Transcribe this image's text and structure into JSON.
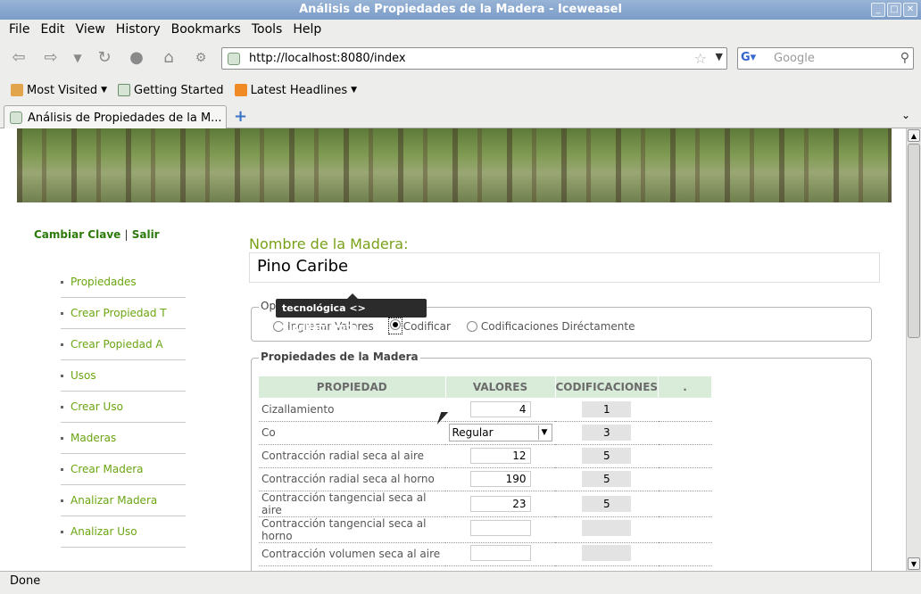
{
  "window": {
    "title": "Análisis de Propiedades de la Madera - Iceweasel"
  },
  "menu": [
    "File",
    "Edit",
    "View",
    "History",
    "Bookmarks",
    "Tools",
    "Help"
  ],
  "nav": {
    "url": "http://localhost:8080/index",
    "search_placeholder": "Google"
  },
  "bookmarks": [
    "Most Visited",
    "Getting Started",
    "Latest Headlines"
  ],
  "tab": {
    "title": "Análisis de Propiedades de la M..."
  },
  "page": {
    "top_links": {
      "change_password": "Cambiar Clave",
      "separator": "|",
      "logout": "Salir"
    },
    "sidebar": [
      "Propiedades",
      "Crear Propiedad T",
      "Crear Popiedad A",
      "Usos",
      "Crear Uso",
      "Maderas",
      "Crear Madera",
      "Analizar Madera",
      "Analizar Uso"
    ],
    "wood_label": "Nombre de la Madera:",
    "wood_name": "Pino Caribe",
    "options": {
      "legend": "Opciones",
      "radio_1": "Ingresar Valores",
      "radio_2": "Codificar",
      "radio_3": "Codificaciones Diréctamente",
      "selected": "Codificar"
    },
    "properties": {
      "legend": "Propiedades de la Madera",
      "headers": [
        "PROPIEDAD",
        "VALORES",
        "CODIFICACIONES",
        "."
      ],
      "rows": [
        {
          "name": "Cizallamiento",
          "value": "4",
          "code": "1"
        },
        {
          "name": "Co",
          "value": "Regular",
          "code": "3"
        },
        {
          "name": "Contracción radial seca al aire",
          "value": "12",
          "code": "5"
        },
        {
          "name": "Contracción radial seca al horno",
          "value": "190",
          "code": "5"
        },
        {
          "name": "Contracción tangencial seca al aire",
          "value": "23",
          "code": "5"
        },
        {
          "name": "Contracción tangencial seca al horno",
          "value": "",
          "code": ""
        },
        {
          "name": "Contracción volumen seca al aire",
          "value": "",
          "code": ""
        }
      ]
    },
    "tooltip": "tecnológica <> Cizallamiento"
  },
  "status": "Done"
}
